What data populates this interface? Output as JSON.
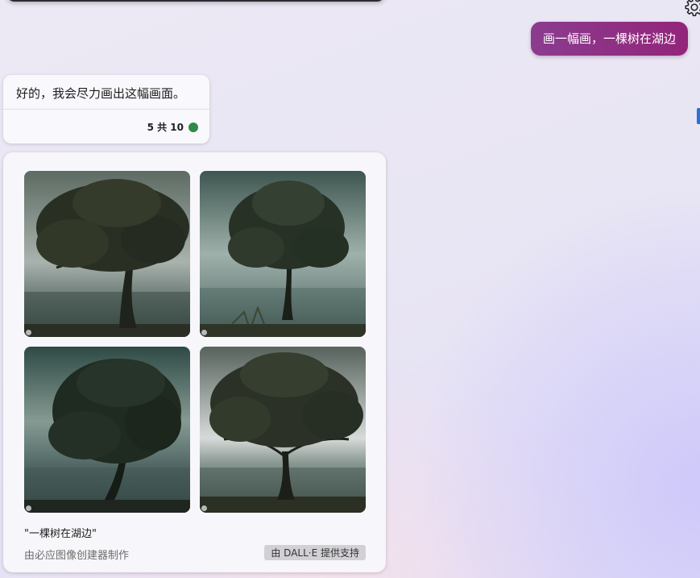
{
  "user_message": "画一幅画，一棵树在湖边",
  "bot_message": {
    "text": "好的，我会尽力画出这幅画面。",
    "turn_counter": "5 共 10"
  },
  "image_result": {
    "caption": "\"一棵树在湖边\"",
    "credit": "由必应图像创建器制作",
    "badge": "由 DALL·E 提供支持"
  },
  "colors": {
    "user_bubble": "#8b3c8f",
    "status_dot": "#2e8a4a"
  },
  "icons": [
    "settings-gear-icon",
    "status-dot-icon"
  ]
}
